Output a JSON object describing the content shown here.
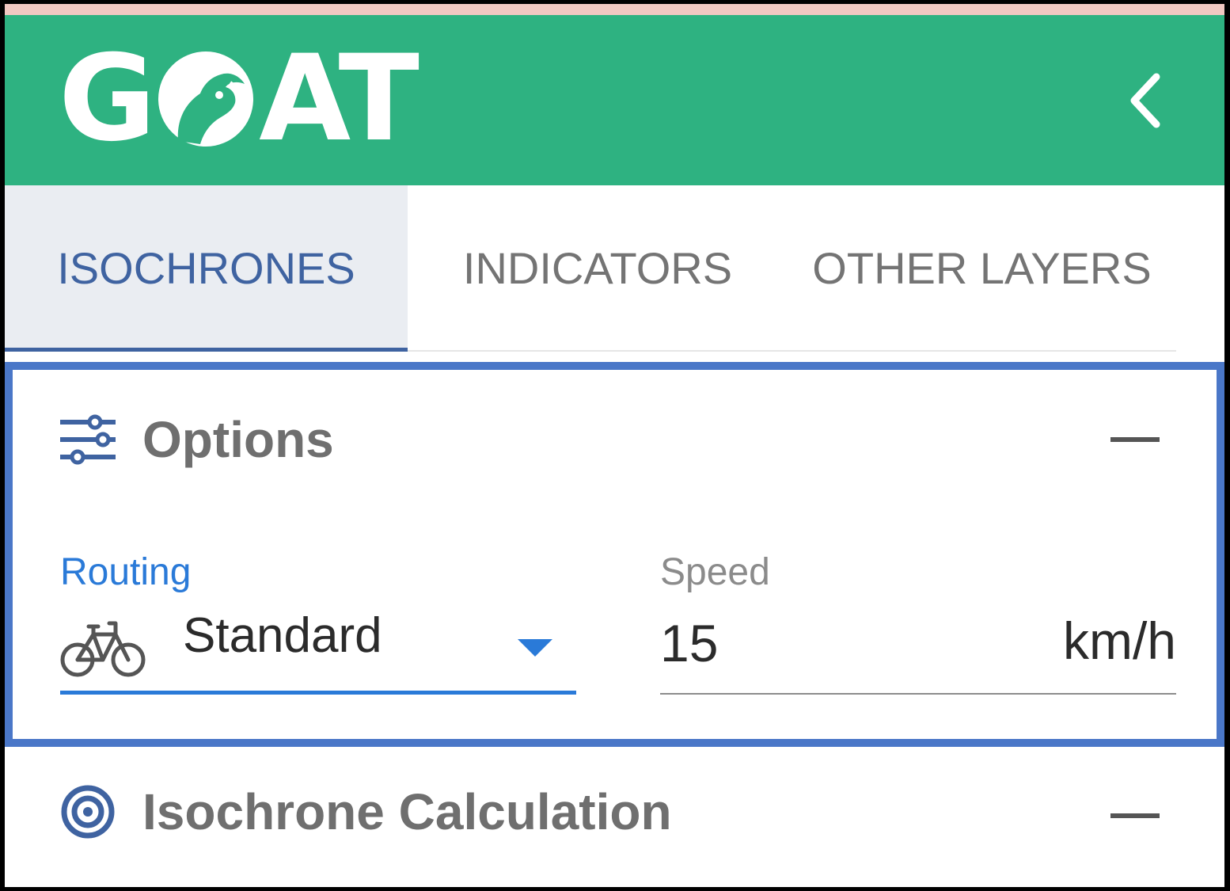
{
  "app": {
    "logo_text_left": "G",
    "logo_text_right": "AT",
    "logo_icon": "goat-head-icon",
    "collapse_icon": "chevron-left-icon"
  },
  "tabs": [
    {
      "label": "ISOCHRONES",
      "active": true
    },
    {
      "label": "INDICATORS",
      "active": false
    },
    {
      "label": "OTHER LAYERS",
      "active": false
    }
  ],
  "options": {
    "title": "Options",
    "icon": "sliders-icon",
    "collapse_icon": "minus-icon",
    "routing": {
      "label": "Routing",
      "value": "Standard",
      "icon": "bicycle-icon"
    },
    "speed": {
      "label": "Speed",
      "value": "15",
      "unit": "km/h"
    }
  },
  "isochrone_calculation": {
    "title": "Isochrone Calculation",
    "icon": "target-icon",
    "collapse_icon": "minus-icon"
  },
  "colors": {
    "header": "#2eb281",
    "accent_blue": "#3f63a1",
    "field_blue": "#2a7ad8",
    "highlight_border": "#4a77c8"
  }
}
